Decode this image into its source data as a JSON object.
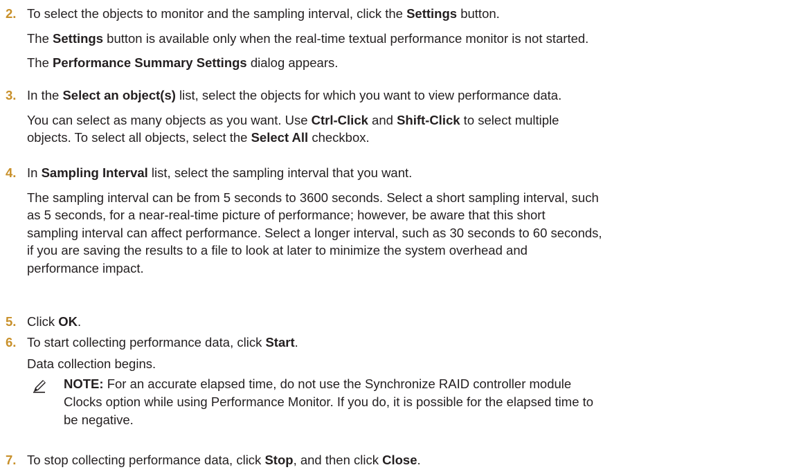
{
  "steps": [
    {
      "number": "2.",
      "lines": [
        [
          {
            "t": "To select the objects to monitor and the sampling interval, click the ",
            "b": false
          },
          {
            "t": "Settings",
            "b": true
          },
          {
            "t": " button.",
            "b": false
          }
        ],
        [
          {
            "t": "The ",
            "b": false
          },
          {
            "t": "Settings",
            "b": true
          },
          {
            "t": " button is available only when the real-time textual performance monitor is not started.",
            "b": false
          }
        ],
        [
          {
            "t": "The ",
            "b": false
          },
          {
            "t": "Performance Summary Settings",
            "b": true
          },
          {
            "t": " dialog appears.",
            "b": false
          }
        ]
      ]
    },
    {
      "number": "3.",
      "lines": [
        [
          {
            "t": "In the ",
            "b": false
          },
          {
            "t": "Select an object(s)",
            "b": true
          },
          {
            "t": " list, select the objects for which you want to view performance data.",
            "b": false
          }
        ],
        [
          {
            "t": "You can select as many objects as you want. Use ",
            "b": false
          },
          {
            "t": "Ctrl-Click",
            "b": true
          },
          {
            "t": " and ",
            "b": false
          },
          {
            "t": "Shift-Click",
            "b": true
          },
          {
            "t": " to select multiple",
            "b": false
          }
        ],
        [
          {
            "t": "objects. To select all objects, select the ",
            "b": false
          },
          {
            "t": "Select All",
            "b": true
          },
          {
            "t": " checkbox.",
            "b": false
          }
        ]
      ]
    },
    {
      "number": "4.",
      "lines": [
        [
          {
            "t": "In ",
            "b": false
          },
          {
            "t": "Sampling Interval",
            "b": true
          },
          {
            "t": " list, select the sampling interval that you want.",
            "b": false
          }
        ],
        [
          {
            "t": "The sampling interval can be from 5 seconds to 3600 seconds. Select a short sampling interval, such",
            "b": false
          }
        ],
        [
          {
            "t": "as 5 seconds, for a near-real-time picture of performance; however, be aware that this short",
            "b": false
          }
        ],
        [
          {
            "t": "sampling interval can affect performance. Select a longer interval, such as 30 seconds to 60 seconds,",
            "b": false
          }
        ],
        [
          {
            "t": "if you are saving the results to a file to look at later to minimize the system overhead and",
            "b": false
          }
        ],
        [
          {
            "t": "performance impact.",
            "b": false
          }
        ]
      ]
    },
    {
      "number": "5.",
      "lines": [
        [
          {
            "t": "Click ",
            "b": false
          },
          {
            "t": "OK",
            "b": true
          },
          {
            "t": ".",
            "b": false
          }
        ]
      ]
    },
    {
      "number": "6.",
      "lines": [
        [
          {
            "t": "To start collecting performance data, click ",
            "b": false
          },
          {
            "t": "Start",
            "b": true
          },
          {
            "t": ".",
            "b": false
          }
        ],
        [
          {
            "t": "Data collection begins.",
            "b": false
          }
        ]
      ]
    },
    {
      "number": "7.",
      "lines": [
        [
          {
            "t": "To stop collecting performance data, click ",
            "b": false
          },
          {
            "t": "Stop",
            "b": true
          },
          {
            "t": ", and then click ",
            "b": false
          },
          {
            "t": "Close",
            "b": true
          },
          {
            "t": ".",
            "b": false
          }
        ]
      ]
    }
  ],
  "note": {
    "icon": "note-pencil-icon",
    "label": "NOTE:",
    "lines": [
      " For an accurate elapsed time, do not use the Synchronize RAID controller module",
      "Clocks option while using Performance Monitor. If you do, it is possible for the elapsed time to",
      "be negative."
    ]
  },
  "colors": {
    "step_number": "#c8902a",
    "text": "#231f20"
  }
}
